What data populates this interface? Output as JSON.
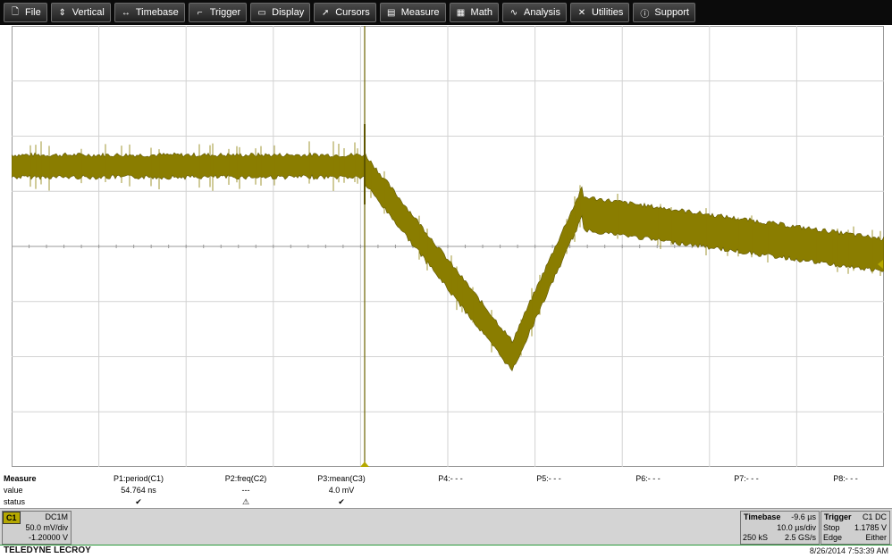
{
  "menu": {
    "items": [
      {
        "label": "File",
        "icon": "file-icon"
      },
      {
        "label": "Vertical",
        "icon": "vertical-arrows-icon"
      },
      {
        "label": "Timebase",
        "icon": "horizontal-arrows-icon"
      },
      {
        "label": "Trigger",
        "icon": "trigger-icon"
      },
      {
        "label": "Display",
        "icon": "display-icon"
      },
      {
        "label": "Cursors",
        "icon": "cursor-icon"
      },
      {
        "label": "Measure",
        "icon": "measure-icon"
      },
      {
        "label": "Math",
        "icon": "calculator-icon"
      },
      {
        "label": "Analysis",
        "icon": "analysis-icon"
      },
      {
        "label": "Utilities",
        "icon": "tools-icon"
      },
      {
        "label": "Support",
        "icon": "info-icon"
      }
    ]
  },
  "colors": {
    "trace": "#8a7d00",
    "trace_dark": "#5e5500",
    "menubar": "#0b0b0b",
    "grid": "#cfcfcf",
    "footer_line": "#2a9a3a"
  },
  "grid": {
    "level_marker": "1"
  },
  "measure": {
    "header": "Measure",
    "row_value": "value",
    "row_status": "status",
    "params": [
      {
        "label": "P1:period(C1)",
        "value": "54.764 ns",
        "status": "✔"
      },
      {
        "label": "P2:freq(C2)",
        "value": "---",
        "status": "⚠"
      },
      {
        "label": "P3:mean(C3)",
        "value": "4.0 mV",
        "status": "✔"
      },
      {
        "label": "P4:- - -",
        "value": "",
        "status": ""
      },
      {
        "label": "P5:- - -",
        "value": "",
        "status": ""
      },
      {
        "label": "P6:- - -",
        "value": "",
        "status": ""
      },
      {
        "label": "P7:- - -",
        "value": "",
        "status": ""
      },
      {
        "label": "P8:- - -",
        "value": "",
        "status": ""
      }
    ]
  },
  "channel": {
    "name": "C1",
    "coupling": "DC1M",
    "vdiv": "50.0 mV/div",
    "offset": "-1.20000 V"
  },
  "timebase": {
    "title": "Timebase",
    "delay": "-9.6 µs",
    "tdiv": "10.0 µs/div",
    "samples": "250 kS",
    "rate": "2.5 GS/s"
  },
  "trigger": {
    "title": "Trigger",
    "source": "C1 DC",
    "mode": "Stop",
    "level": "1.1785 V",
    "type": "Edge",
    "slope": "Either"
  },
  "footer": {
    "brand": "TELEDYNE LECROY",
    "timestamp": "8/26/2014 7:53:39 AM"
  }
}
